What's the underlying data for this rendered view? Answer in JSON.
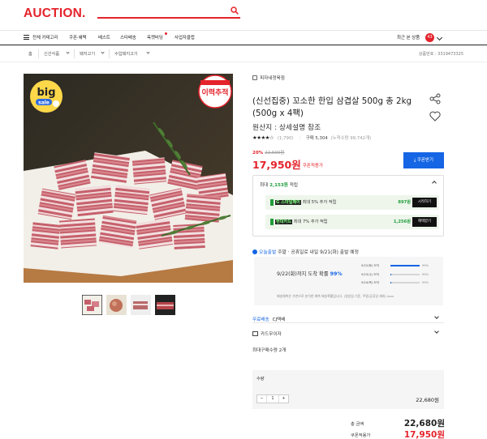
{
  "header": {
    "logo": "AUCTION.",
    "search_value": ""
  },
  "nav": {
    "categories": "전체 카테고리",
    "items": [
      "쿠폰·혜택",
      "베스트",
      "스타배송",
      "옥켓비딩",
      "사업자클럽"
    ],
    "recent": "최근 본 상품",
    "recent_count": "43"
  },
  "breadcrumb": {
    "home": "홈",
    "items": [
      "신선식품",
      "돼지고기",
      "수입돼지고기"
    ],
    "product_no": "상품번호 : 3319473325"
  },
  "colors": {
    "brand": "#e4232b",
    "accent": "#1565e4",
    "benefit": "#1f9d3a"
  },
  "product": {
    "seller": "피자네정육점",
    "title_line1": "(신선집중) 꼬소한 한입 삼겹살 500g 총 2kg",
    "title_line2": "(500g x 4팩)",
    "origin": "원산지 : 상세설명 참조",
    "stars": "★★★★☆",
    "review_count": "(1,790)",
    "purchase": "구매 5,304",
    "purchase_note": "(누적수량 99,742개)",
    "discount_rate": "20%",
    "original_price": "22,600원",
    "price": "17,950원",
    "price_label": "쿠폰적용가",
    "coupon_button": "쿠폰받기"
  },
  "benefit": {
    "head_prefix": "최대",
    "head_amount": "2,153원",
    "head_suffix": "적립",
    "cards": [
      {
        "brand": "G 스마일페이",
        "text": "최대 5% 추가 적립",
        "points": "897원",
        "button": "시작하기"
      },
      {
        "brand": "현대카드",
        "text": "최대 7% 추가 적립",
        "points": "1,256원",
        "button": "혜택받기"
      }
    ]
  },
  "shipping": {
    "today": "오늘출발",
    "text": "주말 · 공휴일로 내일 9/21(화) 출발 예정",
    "forecast_prefix": "9/22(화)까지 도착 확률",
    "forecast_pct": "99%",
    "rows": [
      {
        "label": "9/22(화) 도착",
        "pct": "99%",
        "fill": 0.99
      },
      {
        "label": "9/23(수) 도착",
        "pct": "99%",
        "fill": 0.01
      },
      {
        "label": "9/24(목) 도착",
        "pct": "99%",
        "fill": 0.01
      }
    ],
    "note": "배송예측은 가판으로 분석한 예측 배송확률입니다. (영업일 기준, 주말/공휴일 제외) iaus"
  },
  "options": {
    "delivery_label": "무료배송",
    "delivery_value": "CJ택배",
    "card_label": "카드무이자"
  },
  "max_buy": "최대구매수량 2개",
  "quantity": {
    "label": "수량",
    "value": "1",
    "minus": "−",
    "plus": "+",
    "price": "22,680원"
  },
  "totals": {
    "total_label": "총 금액",
    "total_amount": "22,680원",
    "coupon_label": "쿠폰적용가",
    "coupon_amount": "17,950원"
  }
}
